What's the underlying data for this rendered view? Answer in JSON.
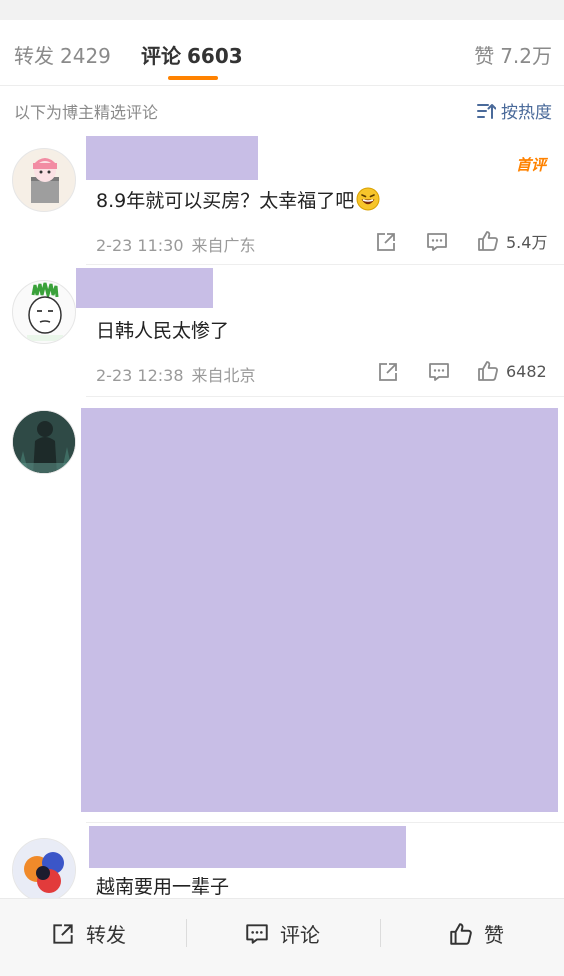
{
  "tabs": {
    "repost": {
      "label": "转发",
      "count": "2429"
    },
    "comment": {
      "label": "评论",
      "count": "6603"
    },
    "like": {
      "label": "赞",
      "count": "7.2万"
    }
  },
  "subheader": {
    "label": "以下为博主精选评论",
    "sort_label": "按热度"
  },
  "comments": [
    {
      "text": "8.9年就可以买房？太幸福了吧",
      "emoji": "laughing-emoji",
      "time": "2-23 11:30",
      "location": "来自广东",
      "likes": "5.4万",
      "badge": "首评"
    },
    {
      "text": "日韩人民太惨了",
      "time": "2-23 12:38",
      "location": "来自北京",
      "likes": "6482"
    },
    {
      "text": ""
    },
    {
      "text": "越南要用一辈子"
    }
  ],
  "bottom_bar": {
    "repost": "转发",
    "comment": "评论",
    "like": "赞"
  },
  "colors": {
    "accent": "#ff8200",
    "redaction": "#c8bee6",
    "sort_link": "#4a6a9a"
  },
  "icons": [
    "share-icon",
    "comment-icon",
    "like-icon",
    "sort-icon"
  ]
}
